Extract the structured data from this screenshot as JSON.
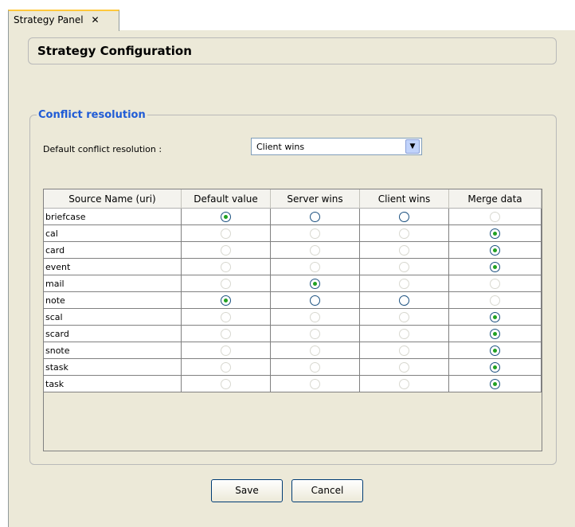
{
  "tab": {
    "label": "Strategy Panel",
    "close": "✕"
  },
  "header": {
    "title": "Strategy Configuration"
  },
  "conflict": {
    "legend": "Conflict resolution",
    "default_label": "Default conflict resolution :",
    "default_value": "Client wins"
  },
  "table": {
    "columns": [
      "Source Name (uri)",
      "Default value",
      "Server wins",
      "Client wins",
      "Merge data"
    ],
    "rows": [
      {
        "name": "briefcase",
        "states": [
          "on",
          "off",
          "off",
          "disabled"
        ]
      },
      {
        "name": "cal",
        "states": [
          "disabled",
          "disabled",
          "disabled",
          "on"
        ]
      },
      {
        "name": "card",
        "states": [
          "disabled",
          "disabled",
          "disabled",
          "on"
        ]
      },
      {
        "name": "event",
        "states": [
          "disabled",
          "disabled",
          "disabled",
          "on"
        ]
      },
      {
        "name": "mail",
        "states": [
          "disabled",
          "on",
          "disabled",
          "disabled"
        ]
      },
      {
        "name": "note",
        "states": [
          "on",
          "off",
          "off",
          "disabled"
        ]
      },
      {
        "name": "scal",
        "states": [
          "disabled",
          "disabled",
          "disabled",
          "on"
        ]
      },
      {
        "name": "scard",
        "states": [
          "disabled",
          "disabled",
          "disabled",
          "on"
        ]
      },
      {
        "name": "snote",
        "states": [
          "disabled",
          "disabled",
          "disabled",
          "on"
        ]
      },
      {
        "name": "stask",
        "states": [
          "disabled",
          "disabled",
          "disabled",
          "on"
        ]
      },
      {
        "name": "task",
        "states": [
          "disabled",
          "disabled",
          "disabled",
          "on"
        ]
      }
    ]
  },
  "buttons": {
    "save": "Save",
    "cancel": "Cancel"
  },
  "colors": {
    "legend": "#1f5bd6",
    "radio_dot": "#21a121",
    "panel_bg": "#ece9d8"
  }
}
